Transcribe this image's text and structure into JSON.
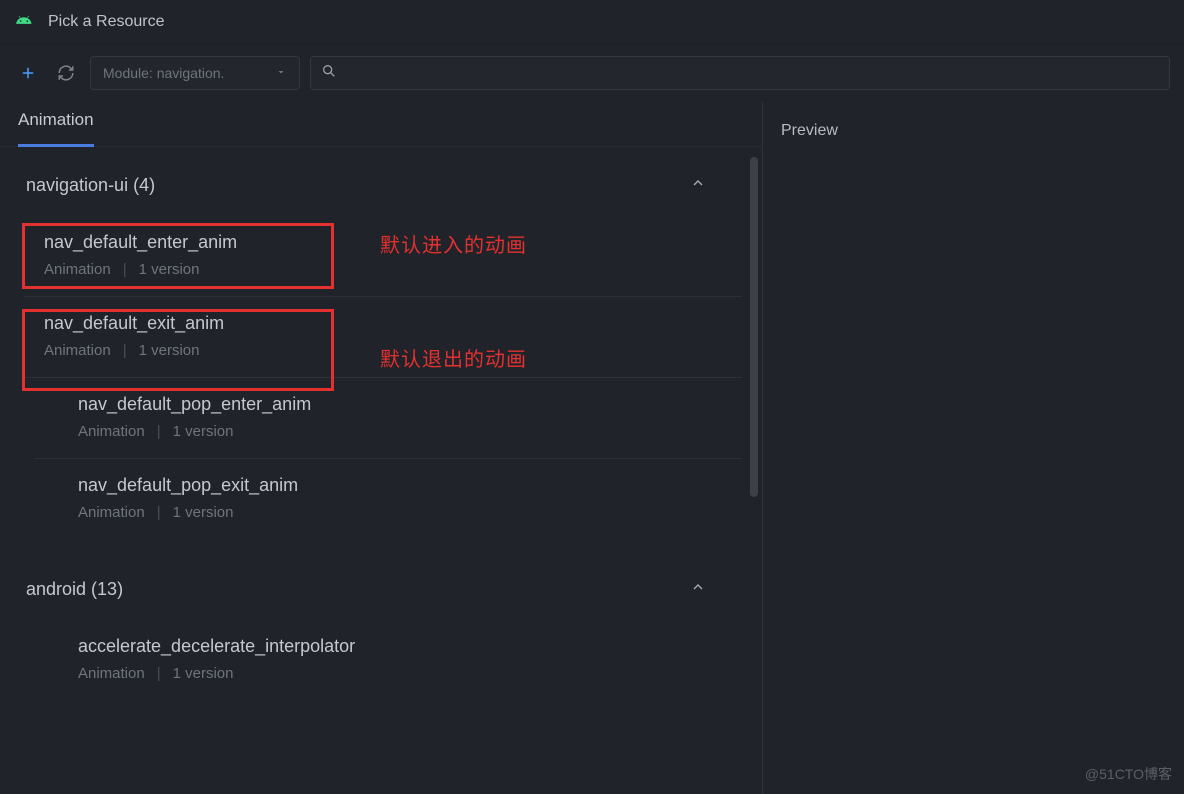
{
  "window": {
    "title": "Pick a Resource"
  },
  "toolbar": {
    "module_label": "Module: navigation.",
    "search_placeholder": ""
  },
  "tabs": {
    "active": "Animation"
  },
  "preview": {
    "title": "Preview"
  },
  "groups": [
    {
      "title": "navigation-ui (4)",
      "expanded": true,
      "items": [
        {
          "name": "nav_default_enter_anim",
          "type": "Animation",
          "versions": "1 version"
        },
        {
          "name": "nav_default_exit_anim",
          "type": "Animation",
          "versions": "1 version"
        },
        {
          "name": "nav_default_pop_enter_anim",
          "type": "Animation",
          "versions": "1 version"
        },
        {
          "name": "nav_default_pop_exit_anim",
          "type": "Animation",
          "versions": "1 version"
        }
      ]
    },
    {
      "title": "android (13)",
      "expanded": true,
      "items": [
        {
          "name": "accelerate_decelerate_interpolator",
          "type": "Animation",
          "versions": "1 version"
        }
      ]
    }
  ],
  "annotations": {
    "enter": "默认进入的动画",
    "exit": "默认退出的动画"
  },
  "watermark": "@51CTO博客"
}
